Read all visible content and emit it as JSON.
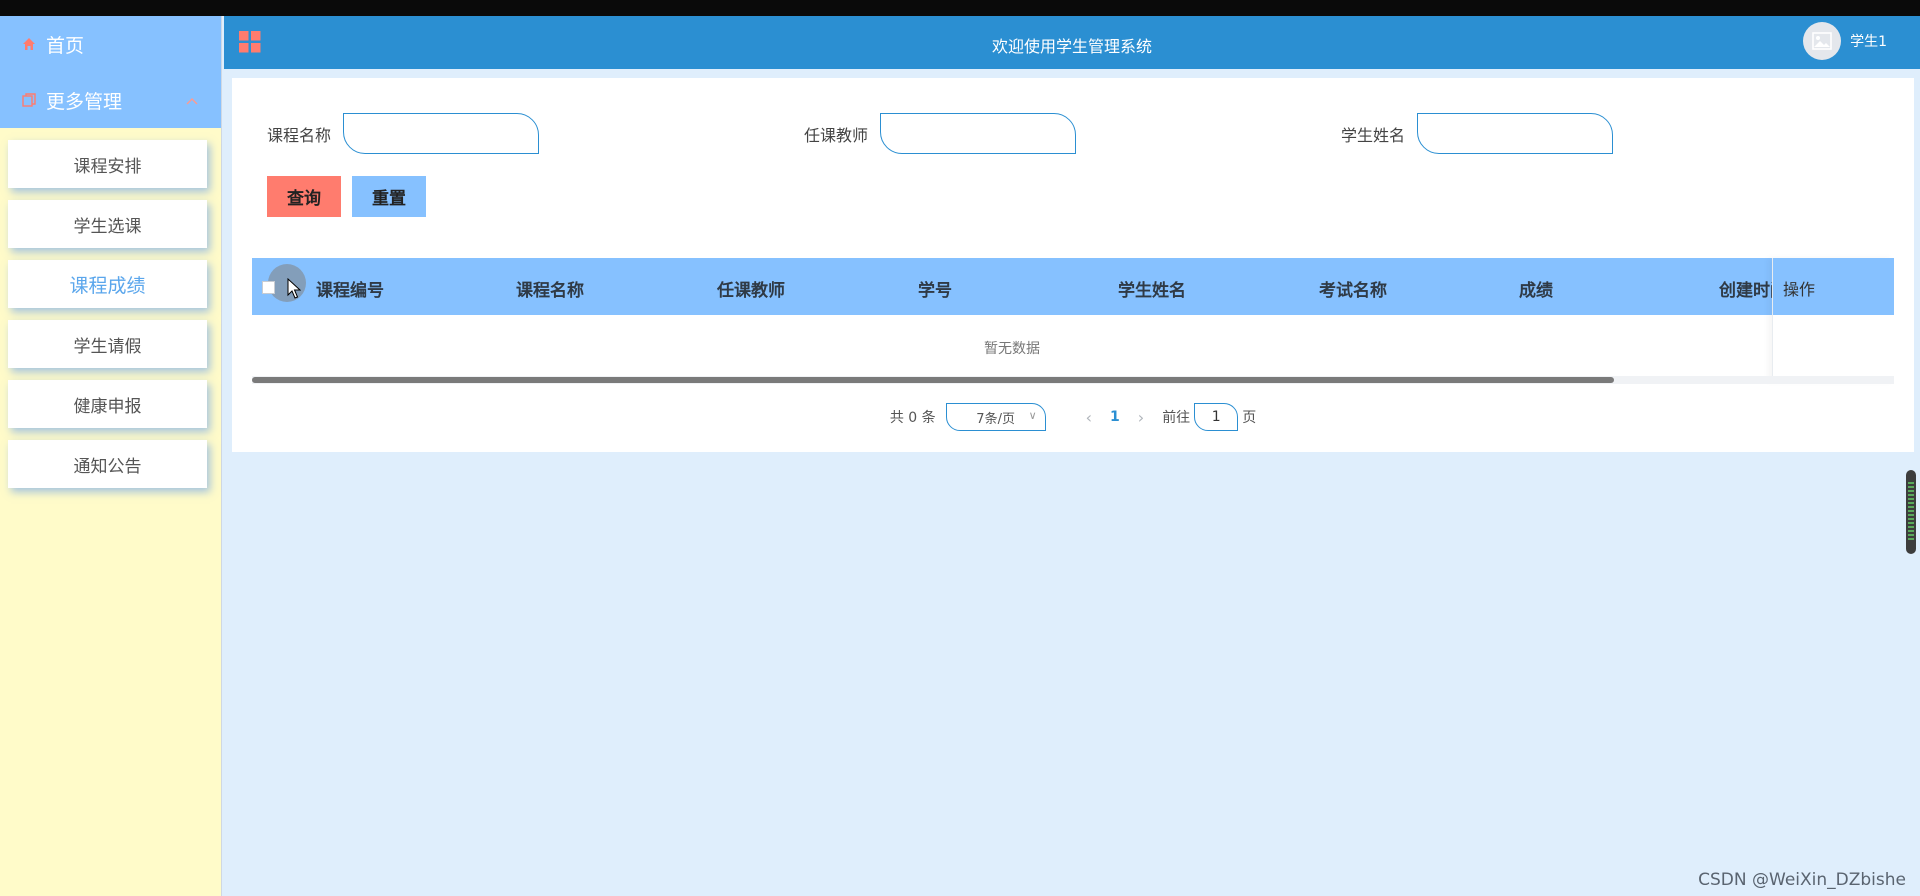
{
  "sidebar": {
    "home_label": "首页",
    "more_label": "更多管理",
    "items": [
      {
        "label": "课程安排"
      },
      {
        "label": "学生选课"
      },
      {
        "label": "课程成绩"
      },
      {
        "label": "学生请假"
      },
      {
        "label": "健康申报"
      },
      {
        "label": "通知公告"
      }
    ],
    "active_item": "课程成绩"
  },
  "header": {
    "title": "欢迎使用学生管理系统",
    "user_name": "学生1"
  },
  "search": {
    "fields": [
      {
        "label": "课程名称",
        "value": ""
      },
      {
        "label": "任课教师",
        "value": ""
      },
      {
        "label": "学生姓名",
        "value": ""
      }
    ],
    "query_label": "查询",
    "reset_label": "重置"
  },
  "table": {
    "columns": [
      "课程编号",
      "课程名称",
      "任课教师",
      "学号",
      "学生姓名",
      "考试名称",
      "成绩",
      "创建时间"
    ],
    "op_column": "操作",
    "empty_text": "暂无数据"
  },
  "pagination": {
    "total_text": "共 0 条",
    "page_size": "7条/页",
    "current_page": "1",
    "goto_label": "前往",
    "goto_value": "1",
    "page_suffix": "页"
  },
  "watermark": "CSDN @WeiXin_DZbishe",
  "colors": {
    "header": "#2b8fd2",
    "sidebar_top": "#86c1ff",
    "sidebar_bg": "#fffbc9",
    "query_button": "#ff7c6e",
    "reset_button": "#86c1ff",
    "table_header": "#86c1ff",
    "page_bg": "#dfeefc"
  }
}
